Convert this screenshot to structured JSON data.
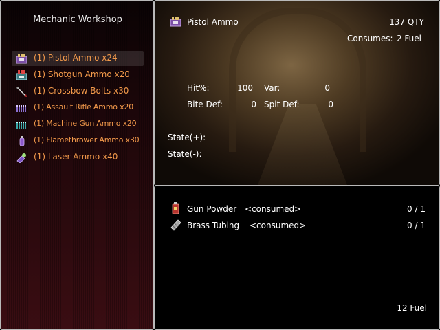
{
  "left_panel": {
    "title": "Mechanic Workshop",
    "items": [
      {
        "label": "(1) Pistol Ammo x24",
        "icon": "ammo-box-icon"
      },
      {
        "label": "(1) Shotgun Ammo x20",
        "icon": "shotgun-shells-icon"
      },
      {
        "label": "(1) Crossbow Bolts x30",
        "icon": "crossbow-bolt-icon"
      },
      {
        "label": "(1) Assault Rifle Ammo x20",
        "icon": "rifle-rounds-icon"
      },
      {
        "label": "(1) Machine Gun Ammo x20",
        "icon": "machine-gun-rounds-icon"
      },
      {
        "label": "(1) Flamethrower Ammo x30",
        "icon": "fuel-canister-icon"
      },
      {
        "label": "(1) Laser Ammo x40",
        "icon": "laser-cell-icon"
      }
    ]
  },
  "detail": {
    "item_name": "Pistol Ammo",
    "quantity": "137 QTY",
    "consumes_label": "Consumes:",
    "consumes_value": "2 Fuel",
    "hit_label": "Hit%:",
    "hit_value": "100",
    "var_label": "Var:",
    "var_value": "0",
    "bite_def_label": "Bite Def:",
    "bite_def_value": "0",
    "spit_def_label": "Spit Def:",
    "spit_def_value": "0",
    "state_plus_label": "State(+):",
    "state_minus_label": "State(-):"
  },
  "materials": {
    "rows": [
      {
        "name": "Gun Powder",
        "status": "<consumed>",
        "count": "0 / 1",
        "icon": "gunpowder-icon"
      },
      {
        "name": "Brass Tubing",
        "status": "<consumed>",
        "count": "0 / 1",
        "icon": "brass-tubing-icon"
      }
    ],
    "fuel_total": "12 Fuel"
  },
  "colors": {
    "item_text": "#f39a4b",
    "panel_border": "#b9b9b9"
  }
}
